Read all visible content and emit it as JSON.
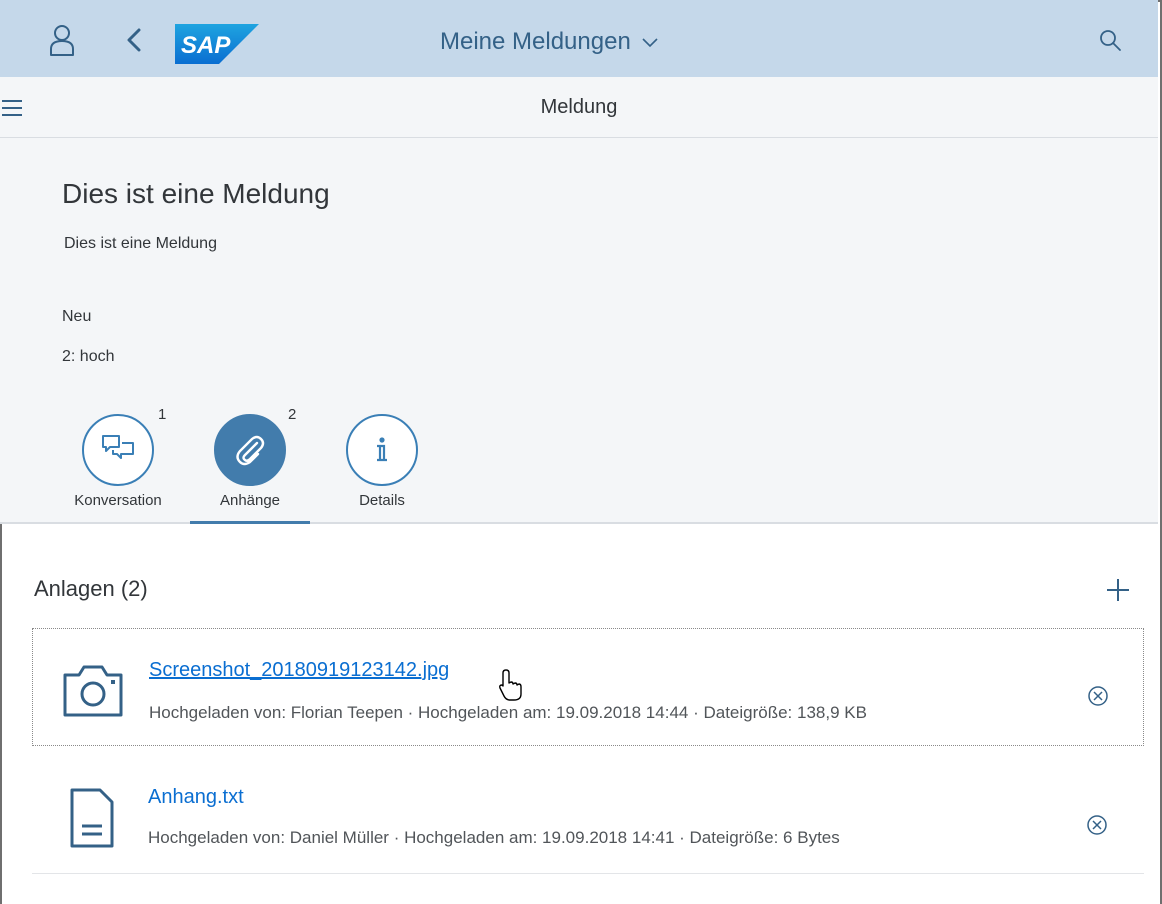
{
  "shell": {
    "app_title": "Meine Meldungen",
    "logo_text": "SAP",
    "icons": [
      "user-icon",
      "back-icon",
      "chevron-down-icon",
      "search-icon"
    ]
  },
  "subheader": {
    "title": "Meldung",
    "icons": [
      "menu-icon"
    ]
  },
  "object": {
    "title": "Dies ist eine Meldung",
    "description": "Dies ist eine Meldung",
    "status": "Neu",
    "priority": "2: hoch"
  },
  "tabs": [
    {
      "label": "Konversation",
      "count": "1",
      "icon": "conversation-icon",
      "active": false
    },
    {
      "label": "Anhänge",
      "count": "2",
      "icon": "paperclip-icon",
      "active": true
    },
    {
      "label": "Details",
      "count": "",
      "icon": "info-icon",
      "active": false
    }
  ],
  "attachments": {
    "title": "Anlagen (2)",
    "items": [
      {
        "name": "Screenshot_20180919123142.jpg",
        "meta": "Hochgeladen von: Florian Teepen · Hochgeladen am: 19.09.2018 14:44 · Dateigröße: 138,9 KB",
        "icon": "camera-icon"
      },
      {
        "name": "Anhang.txt",
        "meta": "Hochgeladen von: Daniel Müller · Hochgeladen am: 19.09.2018 14:41 · Dateigröße: 6 Bytes",
        "icon": "document-icon"
      }
    ]
  },
  "colors": {
    "shellbar": "#c5d8ea",
    "accent": "#427cac",
    "link": "#0a6ed1",
    "header_bg": "#f4f6f8"
  }
}
